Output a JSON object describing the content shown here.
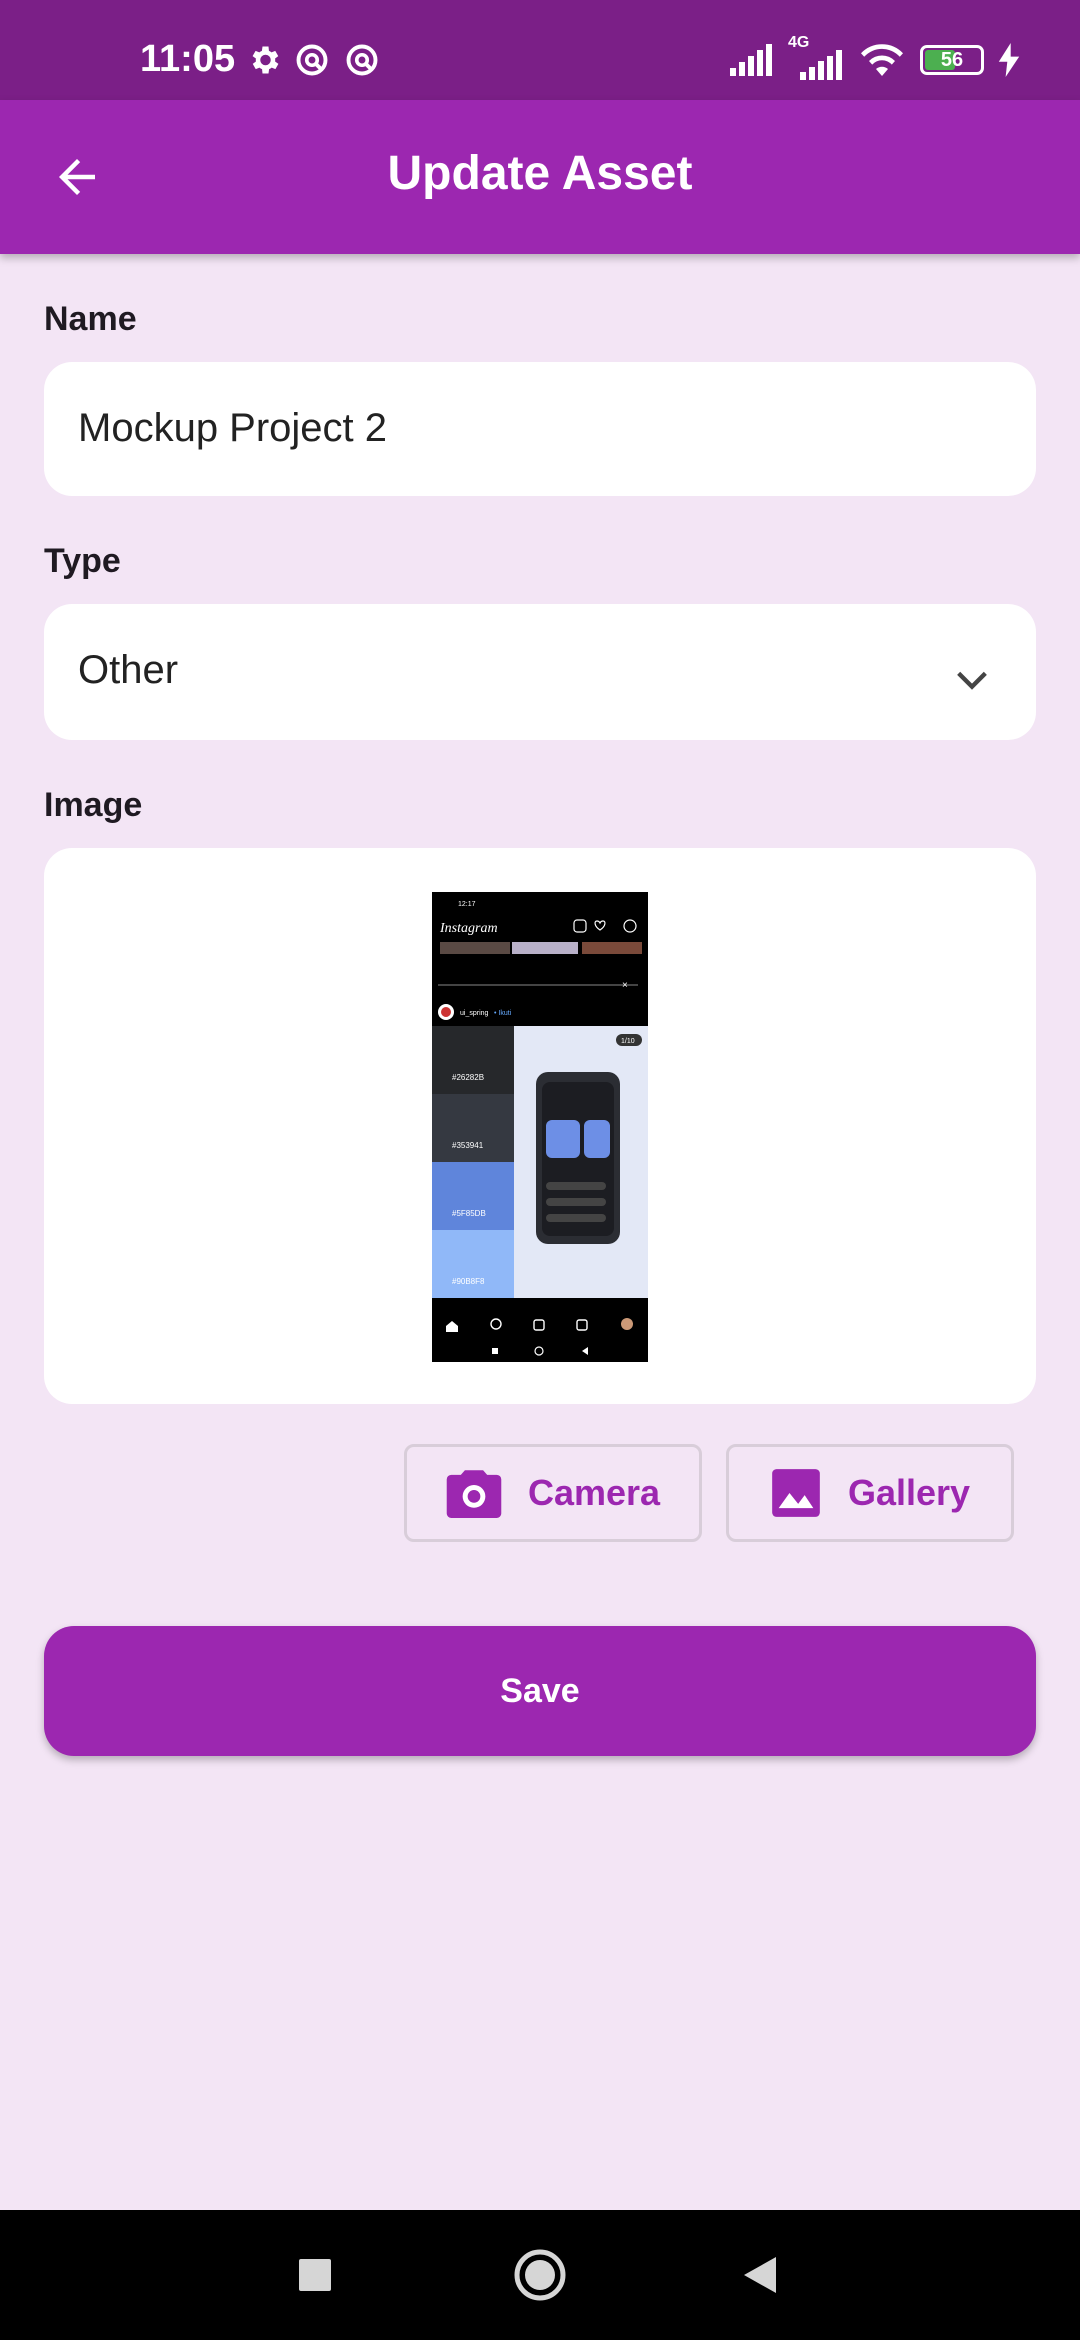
{
  "status_bar": {
    "time": "11:05",
    "network_label": "4G",
    "battery_level": "56",
    "battery_fraction": 0.56,
    "icons": [
      "gear-icon",
      "data-saver-icon",
      "data-saver-icon",
      "signal-icon",
      "signal-icon",
      "wifi-icon",
      "battery-icon",
      "charging-icon"
    ]
  },
  "app_bar": {
    "title": "Update Asset",
    "back_icon": "arrow-left-icon"
  },
  "form": {
    "name_label": "Name",
    "name_value": "Mockup Project 2",
    "type_label": "Type",
    "type_value": "Other",
    "image_label": "Image"
  },
  "thumbnail": {
    "app_name": "Instagram",
    "time": "12:17",
    "username": "ui_spring",
    "follow": "• Ikuti",
    "swatches": [
      "#26282B",
      "#353941",
      "#5F85DB",
      "#90B8F8"
    ],
    "page_badge": "1/10"
  },
  "buttons": {
    "camera_label": "Camera",
    "gallery_label": "Gallery",
    "save_label": "Save"
  },
  "colors": {
    "primary": "#9c27b0",
    "status_bar": "#7b1f87",
    "background": "#f3e5f5"
  }
}
